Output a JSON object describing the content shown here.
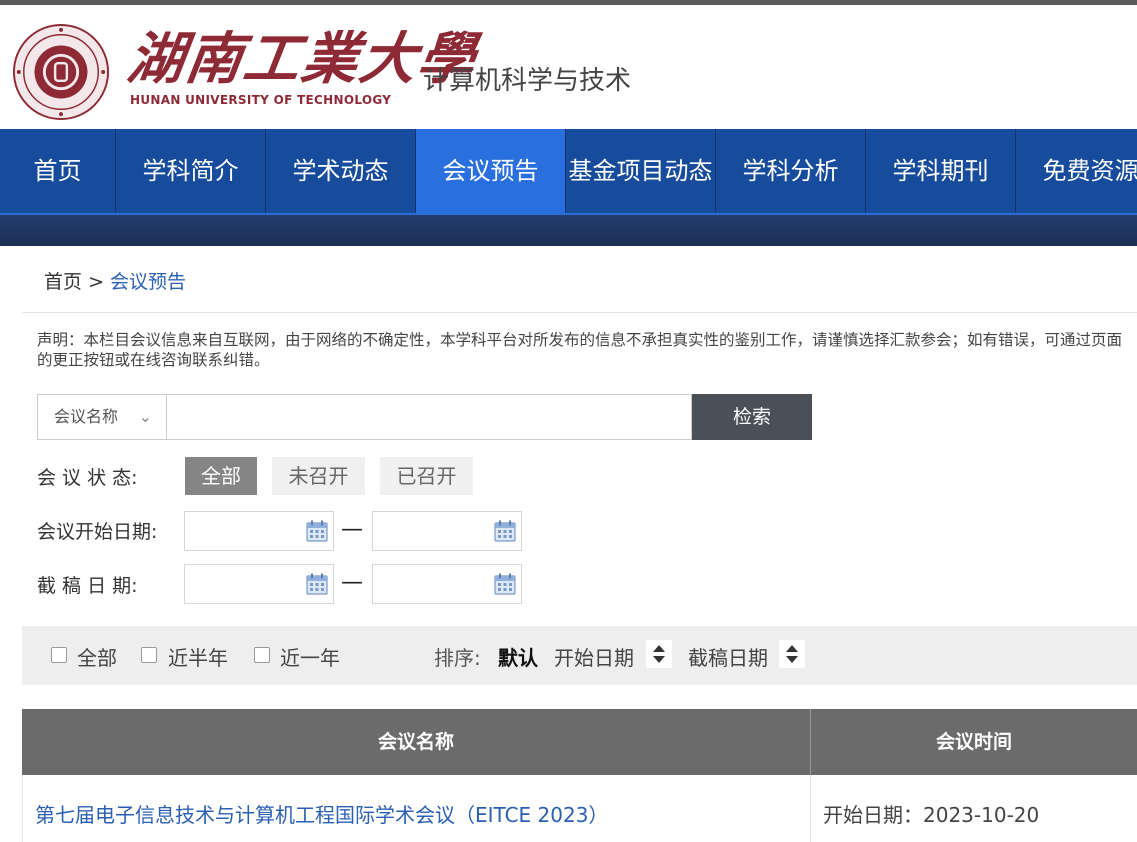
{
  "header": {
    "logo_cn": "湖南工業大學",
    "logo_en": "HUNAN UNIVERSITY OF TECHNOLOGY",
    "seal_text": "HUNAN UNIVERSITY OF TECHNOLOGY",
    "site_name": "计算机科学与技术"
  },
  "nav": {
    "items": [
      "首页",
      "学科简介",
      "学术动态",
      "会议预告",
      "基金项目动态",
      "学科分析",
      "学科期刊",
      "免费资源"
    ],
    "active_index": 3
  },
  "breadcrumb": {
    "home": "首页",
    "separator": ">",
    "current": "会议预告"
  },
  "notice": "声明：本栏目会议信息来自互联网，由于网络的不确定性，本学科平台对所发布的信息不承担真实性的鉴别工作，请谨慎选择汇款参会；如有错误，可通过页面的更正按钮或在线咨询联系纠错。",
  "search": {
    "field_select": "会议名称",
    "input_value": "",
    "button": "检索"
  },
  "filters": {
    "status_label": "会 议 状 态:",
    "status_options": [
      "全部",
      "未召开",
      "已召开"
    ],
    "status_selected": "全部",
    "start_date_label": "会议开始日期:",
    "deadline_label": "截 稿 日 期:",
    "range_dash": "—"
  },
  "options_bar": {
    "checkboxes": [
      "全部",
      "近半年",
      "近一年"
    ],
    "sort_label": "排序:",
    "sort_default": "默认",
    "sort_options": [
      "开始日期",
      "截稿日期"
    ]
  },
  "table": {
    "headers": [
      "会议名称",
      "会议时间"
    ],
    "rows": [
      {
        "name": "第七届电子信息技术与计算机工程国际学术会议（EITCE 2023）",
        "time": "开始日期：2023-10-20"
      }
    ]
  },
  "colors": {
    "nav_bg": "#164c9b",
    "nav_active": "#2a6fde",
    "brand_red": "#8d2a36",
    "link_blue": "#2b5fb3",
    "table_header": "#6b6b6b"
  }
}
